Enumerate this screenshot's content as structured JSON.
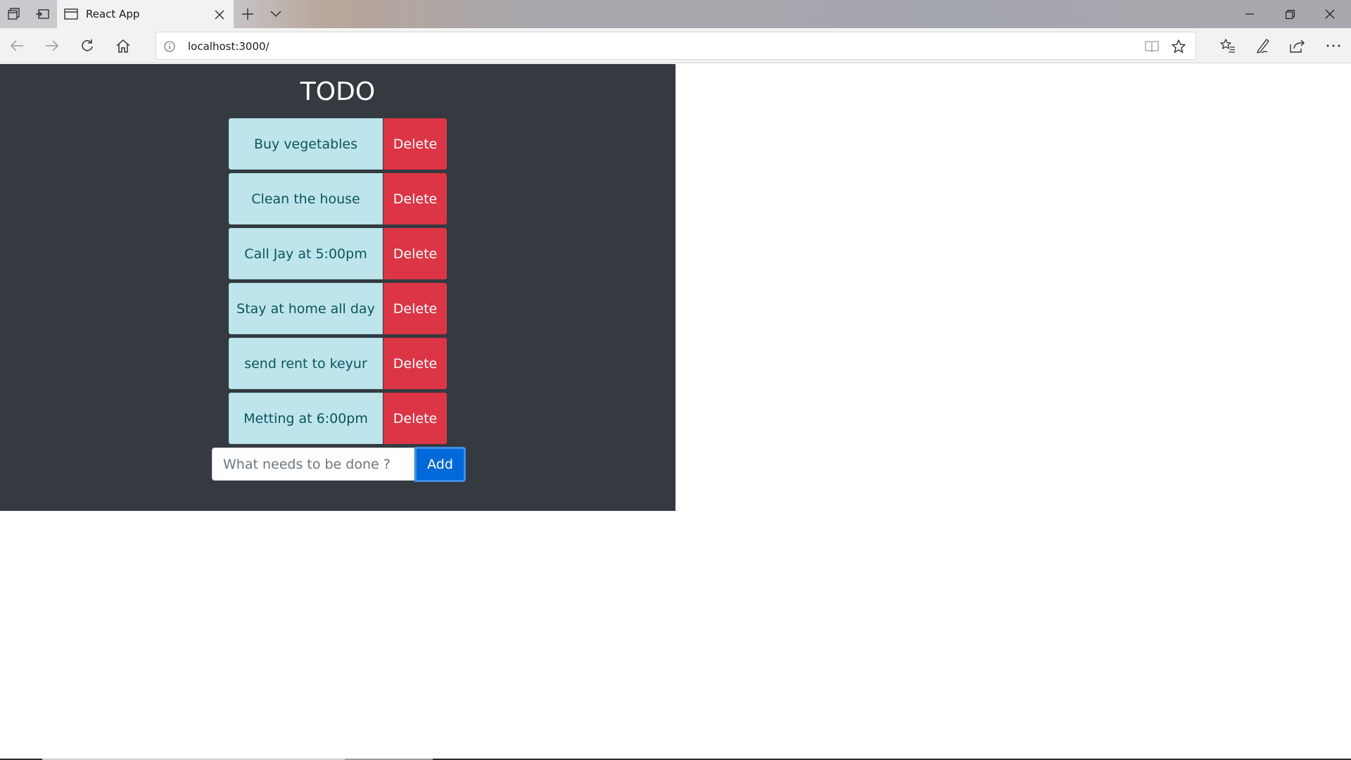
{
  "browser": {
    "tab_title": "React App",
    "url": "localhost:3000/",
    "icons": {
      "tab_actions": "tab-actions-icon",
      "set_aside_tabs": "set-aside-tabs-icon",
      "tab_favicon": "page-icon",
      "tab_close": "close-icon",
      "new_tab": "plus-icon",
      "tab_list": "chevron-down-icon",
      "minimize": "minimize-icon",
      "restore": "restore-icon",
      "close_window": "close-icon",
      "back": "back-arrow-icon",
      "forward": "forward-arrow-icon",
      "refresh": "refresh-icon",
      "home": "home-icon",
      "site_info": "info-icon",
      "reading_view": "reading-view-icon",
      "favorite": "star-icon",
      "favorites_hub": "favorites-list-icon",
      "web_note": "pen-icon",
      "share": "share-icon",
      "more": "more-icon"
    }
  },
  "app": {
    "title": "TODO",
    "todos": [
      {
        "text": "Buy vegetables",
        "delete_label": "Delete"
      },
      {
        "text": "Clean the house",
        "delete_label": "Delete"
      },
      {
        "text": "Call Jay at 5:00pm",
        "delete_label": "Delete"
      },
      {
        "text": "Stay at home all day",
        "delete_label": "Delete"
      },
      {
        "text": "send rent to keyur",
        "delete_label": "Delete"
      },
      {
        "text": "Metting at 6:00pm",
        "delete_label": "Delete"
      }
    ],
    "input": {
      "placeholder": "What needs to be done ?",
      "value": ""
    },
    "add_label": "Add",
    "colors": {
      "background": "#343a40",
      "todo_bg": "#bee5eb",
      "todo_text": "#0c5460",
      "delete_bg": "#dc3545",
      "add_bg": "#0069d9"
    }
  }
}
